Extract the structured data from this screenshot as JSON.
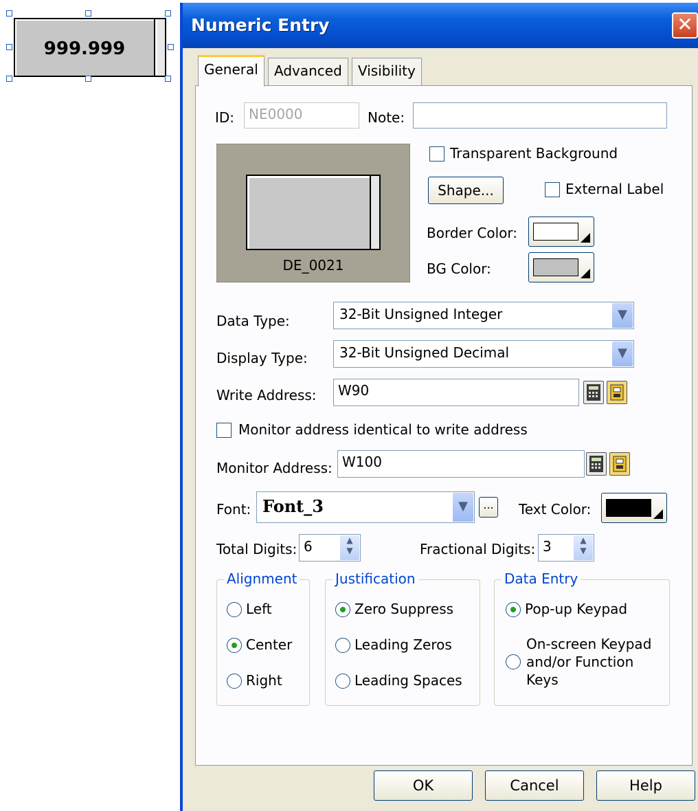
{
  "widget": {
    "value": "999.999"
  },
  "dialog": {
    "title": "Numeric Entry",
    "close_symbol": "✕",
    "tabs": [
      {
        "label": "General"
      },
      {
        "label": "Advanced"
      },
      {
        "label": "Visibility"
      }
    ],
    "active_tab": "General"
  },
  "general": {
    "id_label": "ID:",
    "id_value": "NE0000",
    "note_label": "Note:",
    "note_value": "",
    "preview_caption": "DE_0021",
    "transparent_bg_label": "Transparent Background",
    "transparent_bg_checked": false,
    "shape_button": "Shape...",
    "external_label_label": "External Label",
    "external_label_checked": false,
    "border_color_label": "Border Color:",
    "border_color": "#ffffff",
    "bg_color_label": "BG Color:",
    "bg_color": "#c0c0c0",
    "data_type_label": "Data Type:",
    "data_type_value": "32-Bit Unsigned Integer",
    "display_type_label": "Display Type:",
    "display_type_value": "32-Bit Unsigned Decimal",
    "write_address_label": "Write Address:",
    "write_address_value": "W90",
    "monitor_identical_label": "Monitor address identical to write address",
    "monitor_identical_checked": false,
    "monitor_address_label": "Monitor Address:",
    "monitor_address_value": "W100",
    "font_label": "Font:",
    "font_value": "Font_3",
    "font_more_button": "...",
    "text_color_label": "Text Color:",
    "text_color": "#000000",
    "total_digits_label": "Total Digits:",
    "total_digits_value": "6",
    "fractional_digits_label": "Fractional Digits:",
    "fractional_digits_value": "3"
  },
  "alignment": {
    "title": "Alignment",
    "options": [
      "Left",
      "Center",
      "Right"
    ],
    "selected": "Center"
  },
  "justification": {
    "title": "Justification",
    "options": [
      "Zero Suppress",
      "Leading Zeros",
      "Leading Spaces"
    ],
    "selected": "Zero Suppress"
  },
  "data_entry": {
    "title": "Data Entry",
    "options": [
      "Pop-up Keypad",
      "On-screen Keypad\nand/or Function\nKeys"
    ],
    "selected": "Pop-up Keypad"
  },
  "buttons": {
    "ok": "OK",
    "cancel": "Cancel",
    "help": "Help"
  },
  "colors": {
    "title_bar": "#0550d0",
    "dialog_bg": "#ece9d8",
    "group_title": "#0046d5"
  }
}
